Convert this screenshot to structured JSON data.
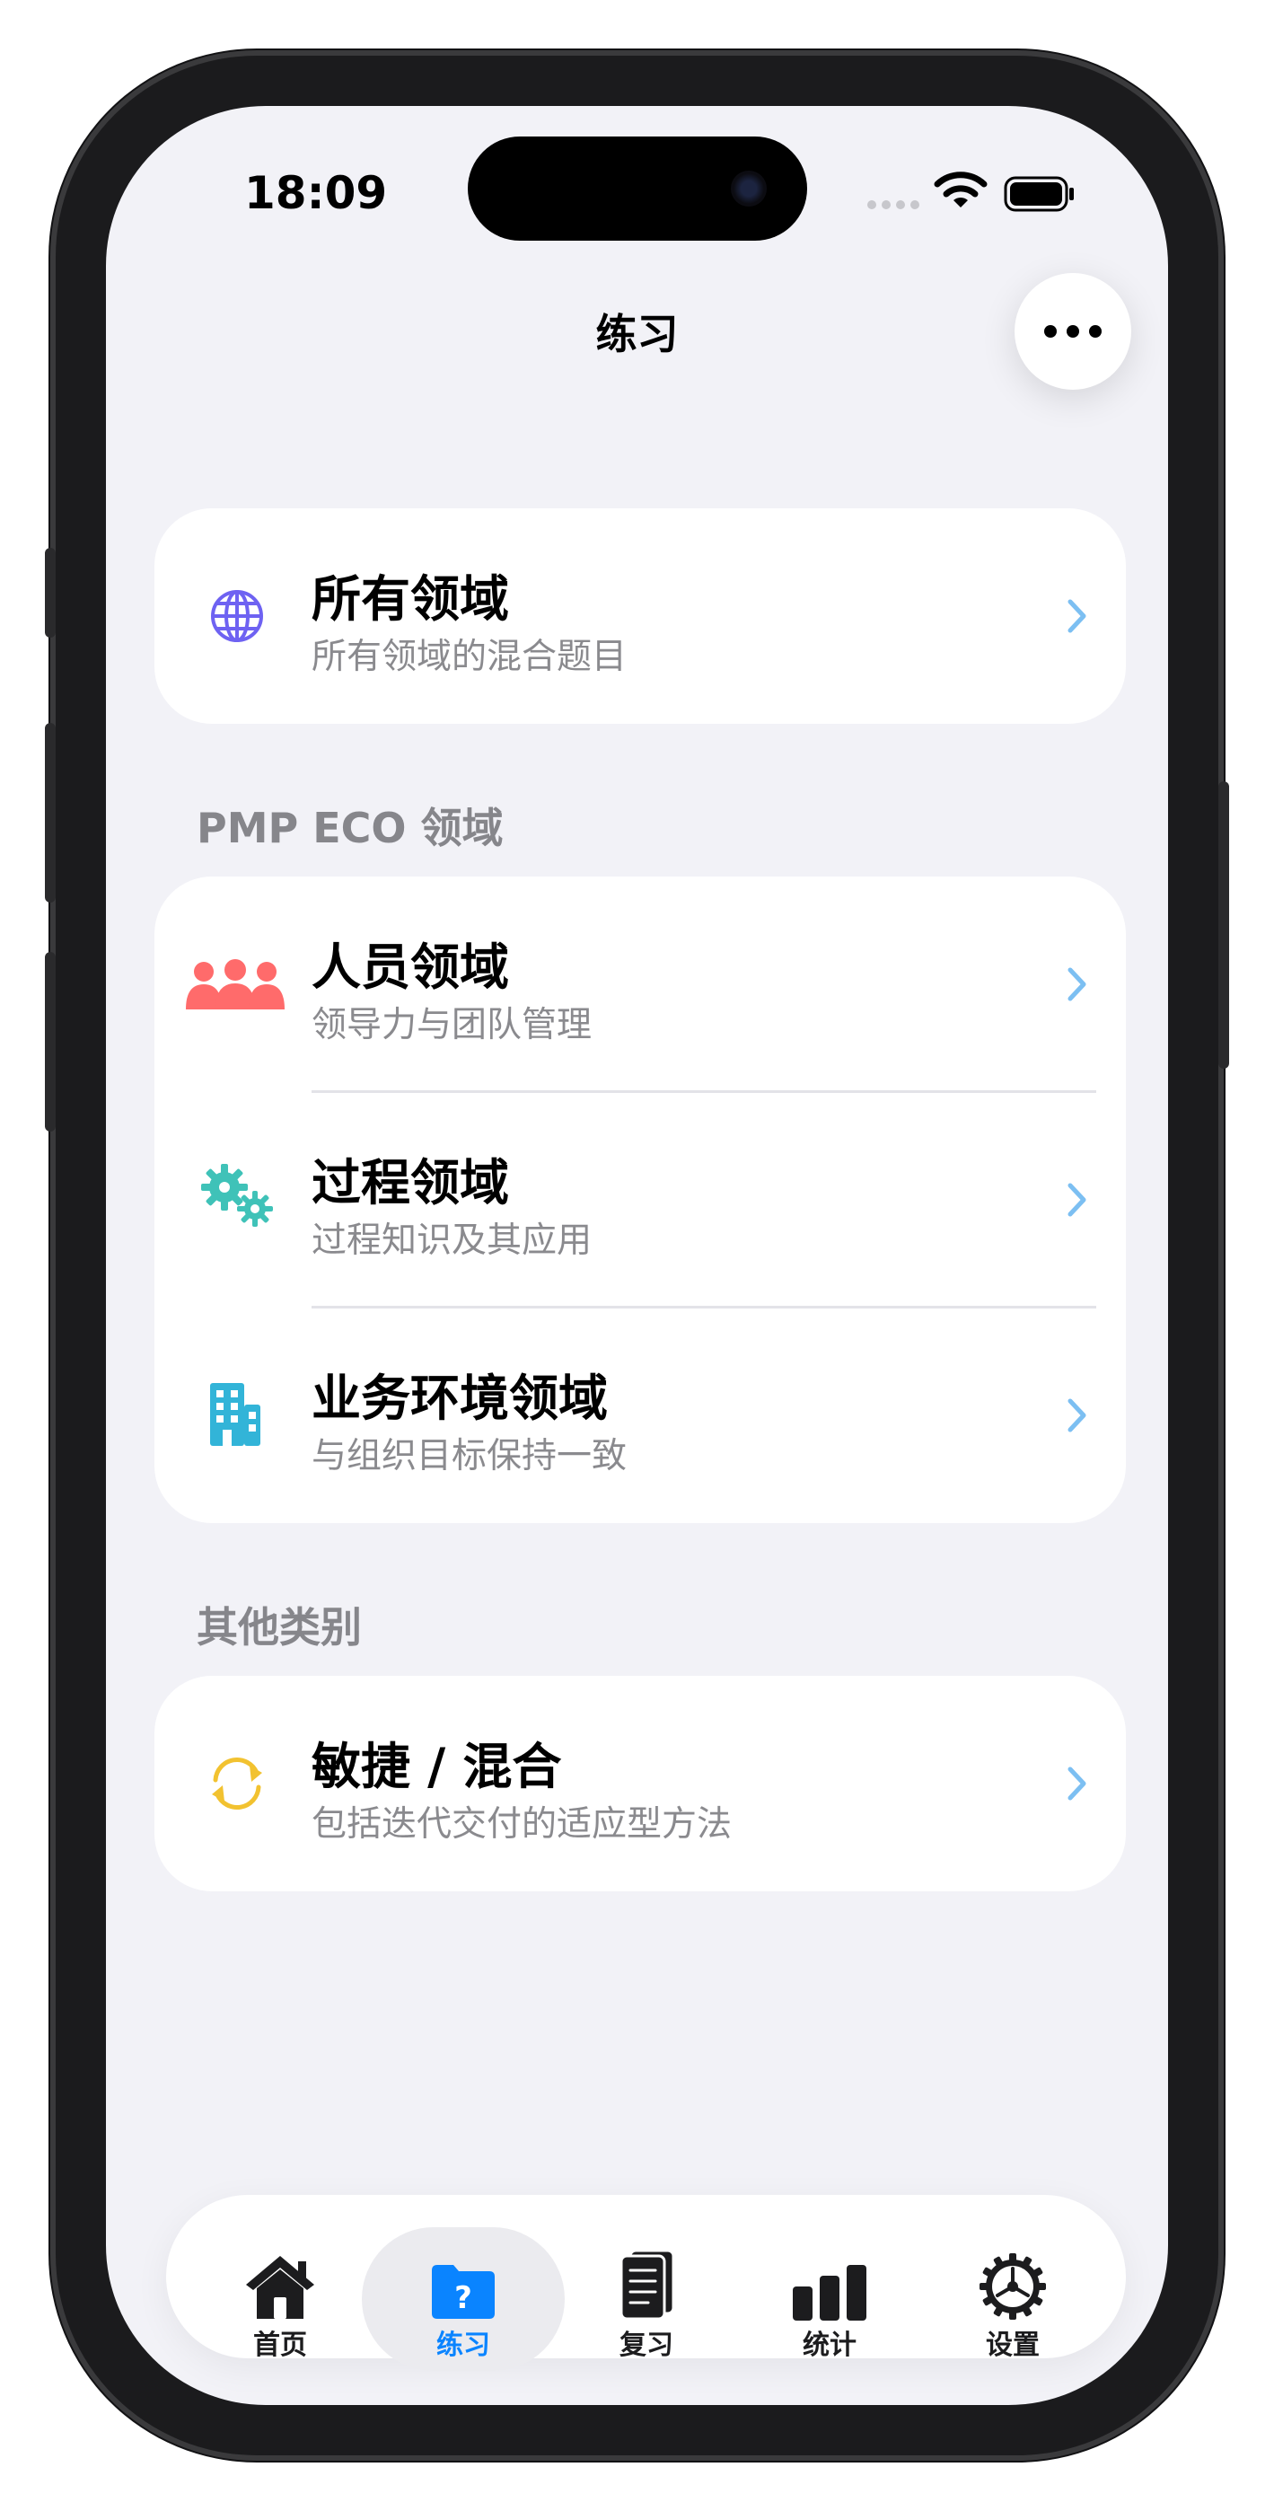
{
  "status_bar": {
    "time": "18:09"
  },
  "nav": {
    "title": "练习",
    "more_icon": "ellipsis-icon"
  },
  "all_domains": {
    "title": "所有领域",
    "subtitle": "所有领域的混合题目",
    "icon": "globe-icon",
    "icon_color": "#6e62f2"
  },
  "eco_section": {
    "header": "PMP ECO 领域",
    "items": [
      {
        "title": "人员领域",
        "subtitle": "领导力与团队管理",
        "icon": "people-icon",
        "icon_color": "#ff6b6b"
      },
      {
        "title": "过程领域",
        "subtitle": "过程知识及其应用",
        "icon": "gears-icon",
        "icon_color": "#3fc2b8"
      },
      {
        "title": "业务环境领域",
        "subtitle": "与组织目标保持一致",
        "icon": "building-icon",
        "icon_color": "#32b4d8"
      }
    ]
  },
  "other_section": {
    "header": "其他类别",
    "items": [
      {
        "title": "敏捷 / 混合",
        "subtitle": "包括迭代交付的适应型方法",
        "icon": "cycle-arrows-icon",
        "icon_color": "#f2c230"
      }
    ]
  },
  "tabbar": {
    "active": "练习",
    "accent_color": "#0a84ff",
    "tabs": [
      {
        "label": "首页",
        "icon": "house-icon"
      },
      {
        "label": "练习",
        "icon": "question-folder-icon"
      },
      {
        "label": "复习",
        "icon": "document-icon"
      },
      {
        "label": "统计",
        "icon": "bar-chart-icon"
      },
      {
        "label": "设置",
        "icon": "gear-icon"
      }
    ]
  }
}
